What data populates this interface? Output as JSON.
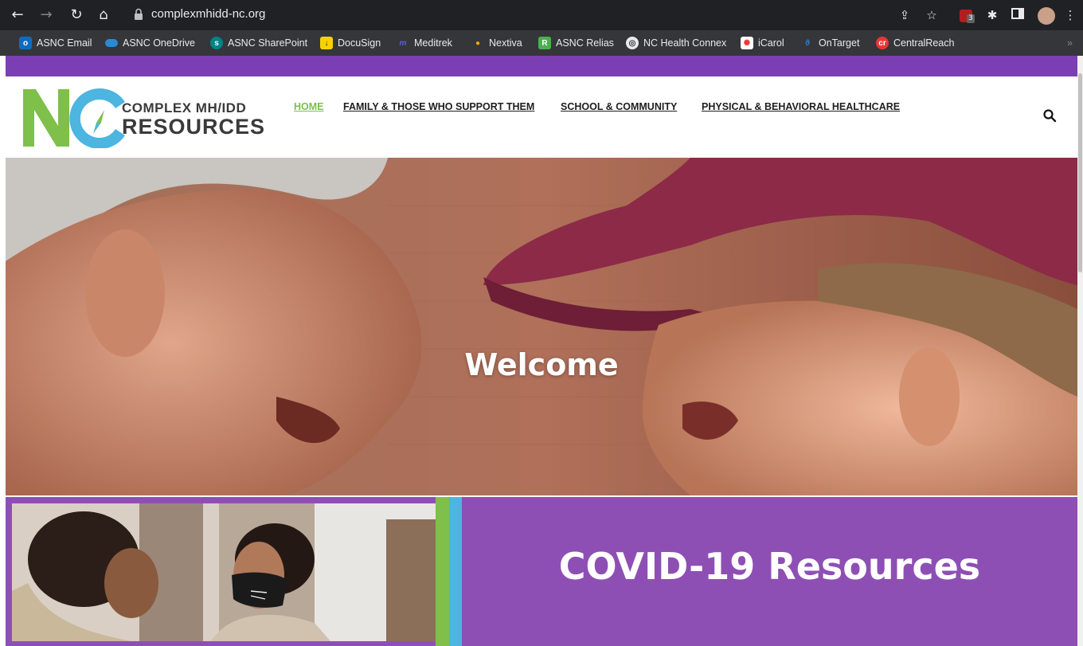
{
  "browser": {
    "url": "complexmhidd-nc.org",
    "extension_badge": "3",
    "bookmarks": [
      {
        "label": "ASNC Email",
        "icon": "outlook-icon",
        "color": "#0f6cbd"
      },
      {
        "label": "ASNC OneDrive",
        "icon": "onedrive-icon",
        "color": "#2a8ad4"
      },
      {
        "label": "ASNC SharePoint",
        "icon": "sharepoint-icon",
        "color": "#038387"
      },
      {
        "label": "DocuSign",
        "icon": "docusign-icon",
        "color": "#f5d300"
      },
      {
        "label": "Meditrek",
        "icon": "meditrek-icon",
        "color": "#3b3fb6"
      },
      {
        "label": "Nextiva",
        "icon": "nextiva-icon",
        "color": "#f2a900"
      },
      {
        "label": "ASNC Relias",
        "icon": "relias-icon",
        "color": "#4caf50"
      },
      {
        "label": "NC Health Connex",
        "icon": "globe-icon",
        "color": "#e8eaed"
      },
      {
        "label": "iCarol",
        "icon": "icarol-icon",
        "color": "#e53935"
      },
      {
        "label": "OnTarget",
        "icon": "ontarget-icon",
        "color": "#2a7fd4"
      },
      {
        "label": "CentralReach",
        "icon": "centralreach-icon",
        "color": "#e53935"
      }
    ]
  },
  "site": {
    "logo": {
      "initials": "NC",
      "line1": "COMPLEX MH/IDD",
      "line2": "RESOURCES"
    },
    "nav": [
      {
        "label": "HOME",
        "active": true
      },
      {
        "label": "FAMILY & THOSE WHO SUPPORT THEM",
        "active": false
      },
      {
        "label": "SCHOOL & COMMUNITY",
        "active": false
      },
      {
        "label": "PHYSICAL & BEHAVIORAL HEALTHCARE",
        "active": false
      }
    ],
    "hero": {
      "title": "Welcome"
    },
    "covid": {
      "title": "COVID-19 Resources"
    },
    "colors": {
      "brand_purple": "#7b3fb3",
      "panel_purple": "#8e4fb5",
      "brand_green": "#7ec04a",
      "brand_blue": "#4cb5e0"
    }
  }
}
